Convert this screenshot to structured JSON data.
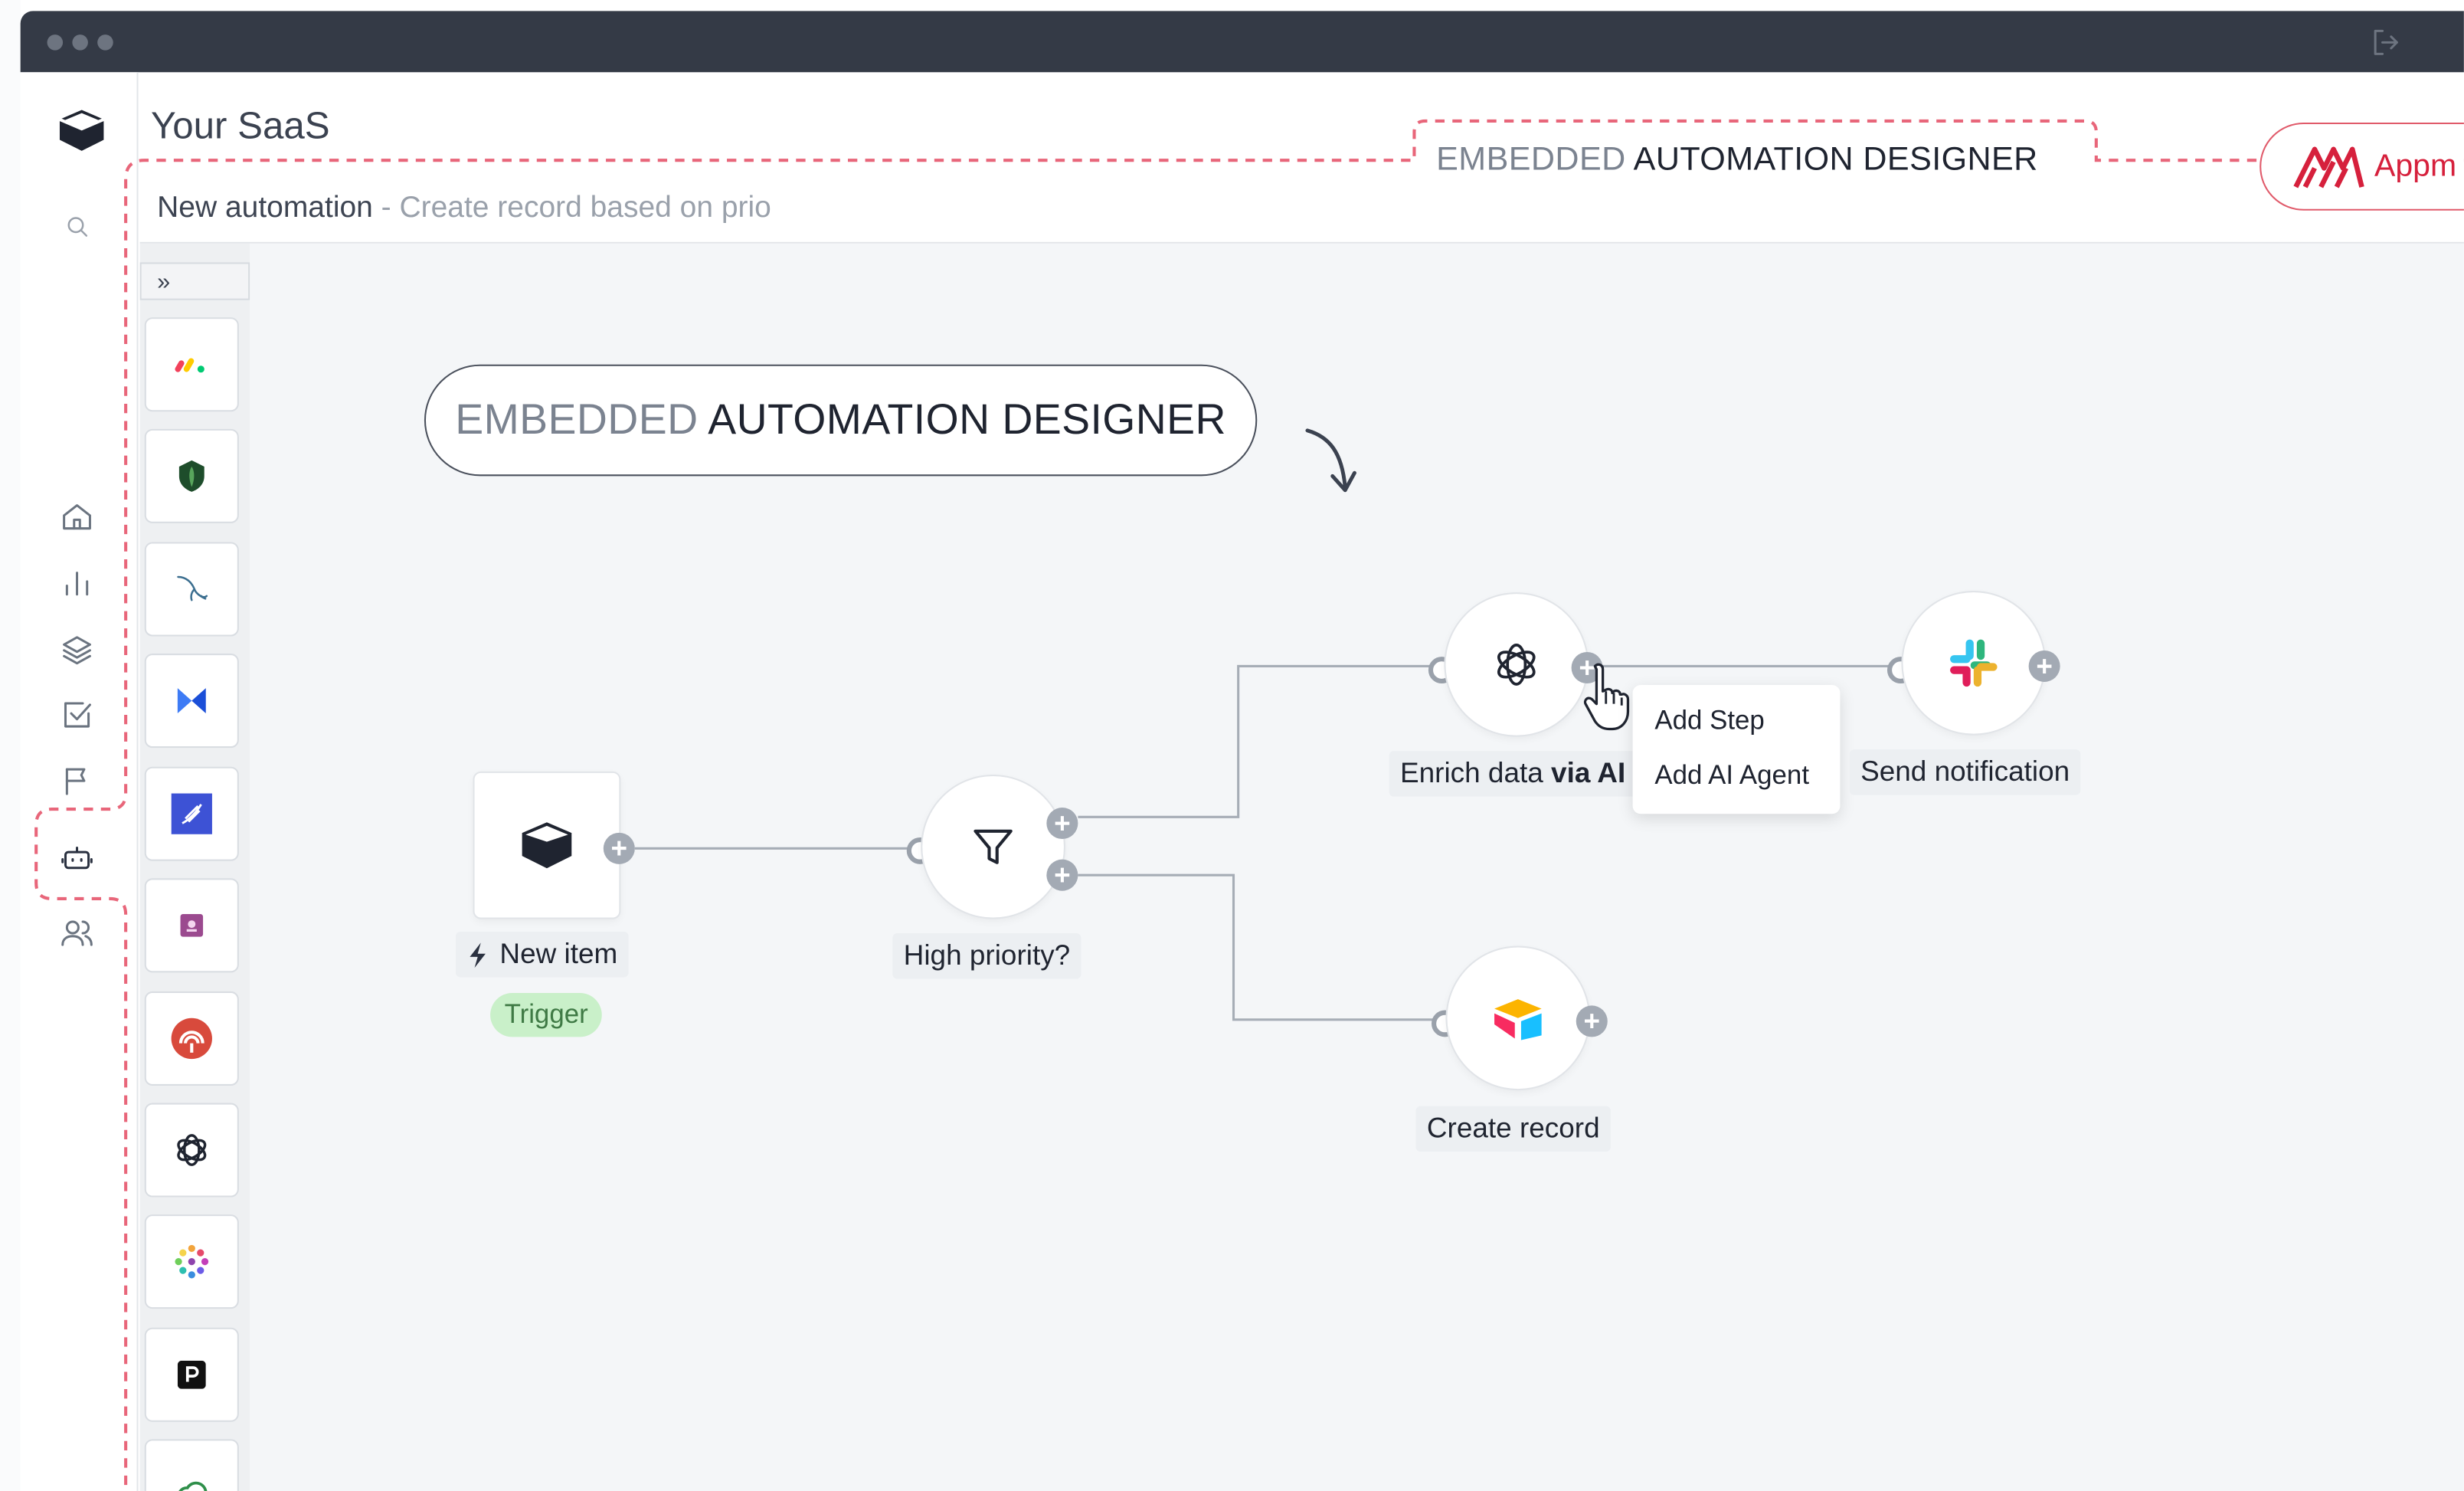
{
  "window": {
    "titlebar_color": "#343a46",
    "exit_icon": "logout-icon"
  },
  "app": {
    "title": "Your SaaS",
    "logo_icon": "box-logo-icon"
  },
  "sidebar": {
    "items": [
      {
        "name": "search",
        "icon": "search-icon"
      },
      {
        "name": "home",
        "icon": "home-icon"
      },
      {
        "name": "analytics",
        "icon": "bar-chart-icon"
      },
      {
        "name": "layers",
        "icon": "layers-icon"
      },
      {
        "name": "tasks",
        "icon": "checkbox-icon"
      },
      {
        "name": "flags",
        "icon": "flag-icon"
      },
      {
        "name": "automations",
        "icon": "robot-icon",
        "highlighted": true
      },
      {
        "name": "users",
        "icon": "users-icon"
      }
    ]
  },
  "embedded_tag": {
    "light": "EMBEDDED",
    "dark": "AUTOMATION DESIGNER",
    "outline_color": "#e8667a"
  },
  "appmixer_badge": {
    "text": "Appm",
    "color": "#d6203c"
  },
  "header": {
    "title": "New automation",
    "subtitle": "- Create record based on prio"
  },
  "palette": {
    "collapse_label": "»",
    "items": [
      "monday-icon",
      "mongodb-icon",
      "mysql-icon",
      "bolt-b-icon",
      "feather-app-icon",
      "purple-app-icon",
      "radar-app-icon",
      "openai-icon",
      "dots-app-icon",
      "producthunt-p-icon",
      "cloud-app-icon"
    ]
  },
  "canvas_tag": {
    "light": "EMBEDDED",
    "dark": "AUTOMATION DESIGNER"
  },
  "flow": {
    "nodes": [
      {
        "id": "trigger",
        "label": "New item",
        "badge": "Trigger",
        "icon": "box-logo-icon"
      },
      {
        "id": "filter",
        "label": "High priority?",
        "icon": "funnel-icon"
      },
      {
        "id": "ai",
        "label_plain": "Enrich data ",
        "label_bold": "via AI",
        "icon": "openai-icon"
      },
      {
        "id": "slack",
        "label": "Send notification",
        "icon": "slack-icon"
      },
      {
        "id": "airtable",
        "label": "Create record",
        "icon": "airtable-icon"
      }
    ],
    "context_menu": [
      "Add Step",
      "Add AI Agent"
    ]
  }
}
